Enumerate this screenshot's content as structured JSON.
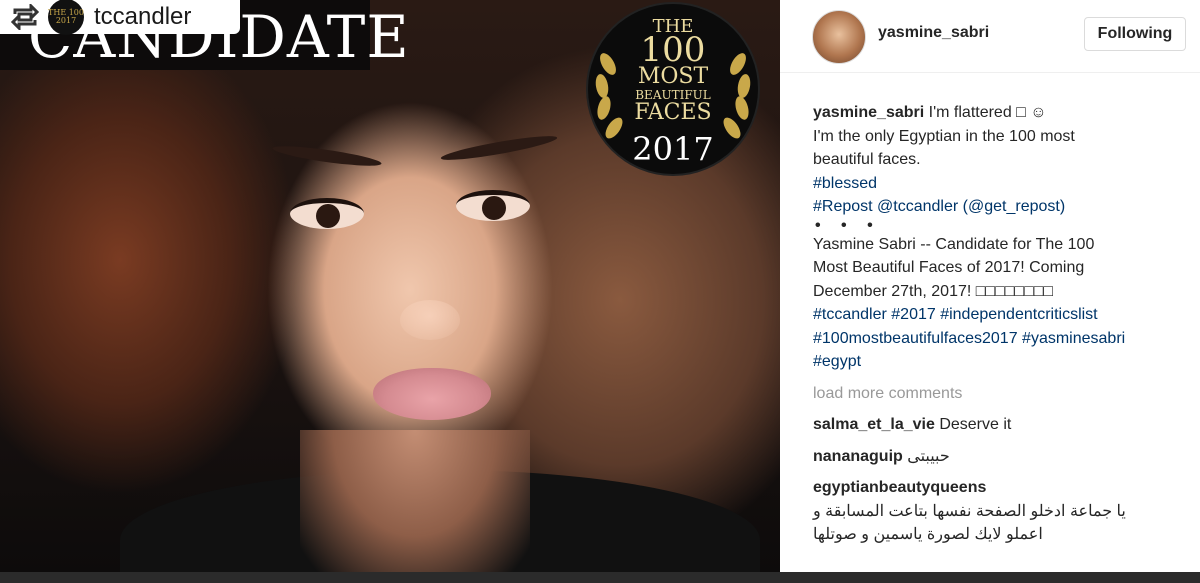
{
  "repost": {
    "username": "tccandler",
    "logo_text": "THE 100 2017"
  },
  "photo": {
    "banner_text": "CANDIDATE",
    "badge": {
      "line1": "THE",
      "line2": "100",
      "line3": "MOST",
      "line4": "BEAUTIFUL",
      "line5": "FACES",
      "line6": "2017"
    }
  },
  "header": {
    "username": "yasmine_sabri",
    "follow_label": "Following"
  },
  "caption": {
    "username": "yasmine_sabri",
    "text1": "I'm flattered □ ☺",
    "text2": "I'm the only Egyptian in the 100 most",
    "text3": "beautiful faces.",
    "tag1": "#blessed",
    "repost_line": "#Repost @tccandler (@get_repost)",
    "dots": "• • •",
    "desc1": "Yasmine Sabri -- Candidate for The 100",
    "desc2": "Most Beautiful Faces of 2017! Coming",
    "desc3": "December 27th, 2017! □□□□□□□□",
    "tags_line1": "#tccandler #2017 #independentcriticslist",
    "tags_line2": "#100mostbeautifulfaces2017 #yasminesabri",
    "tags_line3": "#egypt"
  },
  "load_more": "load more comments",
  "comments": [
    {
      "username": "salma_et_la_vie",
      "text": "Deserve it"
    },
    {
      "username": "nananaguip",
      "text": "حبيبتى"
    },
    {
      "username": "egyptianbeautyqueens",
      "text": "يا جماعة ادخلو الصفحة نفسها بتاعت المسابقة و اعملو لايك لصورة ياسمين و صوتلها"
    }
  ],
  "icons": {
    "repost": "repost-icon",
    "laurel": "laurel-icon"
  },
  "colors": {
    "link": "#003569",
    "muted": "#999999",
    "text": "#262626",
    "gold": "#c9a84a"
  }
}
